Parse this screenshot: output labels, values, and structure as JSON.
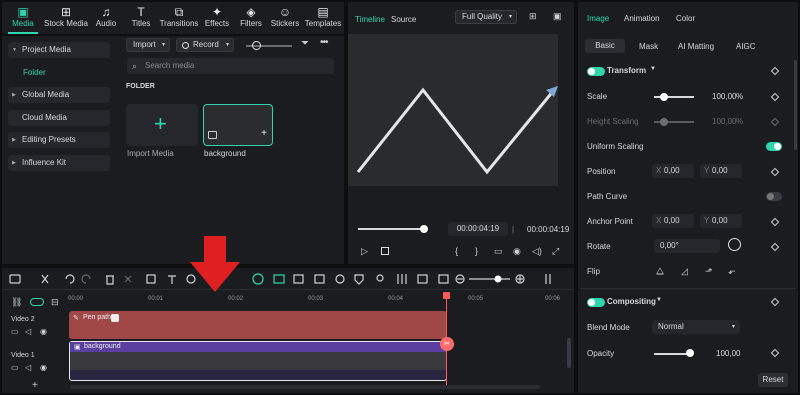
{
  "toolbar": {
    "items": [
      {
        "label": "Media",
        "icon": "media-icon"
      },
      {
        "label": "Stock Media",
        "icon": "stock-media-icon"
      },
      {
        "label": "Audio",
        "icon": "audio-icon"
      },
      {
        "label": "Titles",
        "icon": "titles-icon"
      },
      {
        "label": "Transitions",
        "icon": "transitions-icon"
      },
      {
        "label": "Effects",
        "icon": "effects-icon"
      },
      {
        "label": "Filters",
        "icon": "filters-icon"
      },
      {
        "label": "Stickers",
        "icon": "stickers-icon"
      },
      {
        "label": "Templates",
        "icon": "templates-icon"
      }
    ]
  },
  "sidebar": {
    "items": [
      "Project Media",
      "Folder",
      "Global Media",
      "Cloud Media",
      "Editing Presets",
      "Influence Kit"
    ]
  },
  "media": {
    "import_label": "Import",
    "record_label": "Record",
    "search_placeholder": "Search media",
    "folder_heading": "FOLDER",
    "import_media_label": "Import Media",
    "clip_label": "background"
  },
  "preview": {
    "tab_timeline": "Timeline",
    "tab_source": "Source",
    "quality": "Full Quality",
    "current_time": "00:00:04:19",
    "total_time": "00:00:04:19",
    "progress": 0.98
  },
  "properties": {
    "tabs": [
      "Image",
      "Animation",
      "Color"
    ],
    "subtabs": [
      "Basic",
      "Mask",
      "AI Matting",
      "AIGC"
    ],
    "transform_label": "Transform",
    "scale_label": "Scale",
    "scale_value": "100,00",
    "scale_unit": "%",
    "height_scaling_label": "Height Scaling",
    "height_scaling_value": "100,00",
    "height_scaling_unit": "%",
    "uniform_scaling_label": "Uniform Scaling",
    "position_label": "Position",
    "position_x": "0,00",
    "position_y": "0,00",
    "path_curve_label": "Path Curve",
    "anchor_point_label": "Anchor Point",
    "anchor_x": "0,00",
    "anchor_y": "0,00",
    "rotate_label": "Rotate",
    "rotate_value": "0,00°",
    "flip_label": "Flip",
    "compositing_label": "Compositing",
    "blend_mode_label": "Blend Mode",
    "blend_mode_value": "Normal",
    "opacity_label": "Opacity",
    "opacity_value": "100,00",
    "reset_label": "Reset",
    "x_label": "X",
    "y_label": "Y"
  },
  "timeline": {
    "ruler": [
      "00:00",
      "00:01",
      "00:02",
      "00:03",
      "00:04",
      "00:05",
      "00:06"
    ],
    "tracks": [
      {
        "name": "Video 2",
        "clip": "Pen path"
      },
      {
        "name": "Video 1",
        "clip": "background"
      }
    ]
  },
  "colors": {
    "accent": "#30d5b0",
    "clip_red": "#a04848",
    "clip_purple": "#5b3fa0",
    "playhead": "#ff5a5a",
    "arrow": "#e02020"
  }
}
